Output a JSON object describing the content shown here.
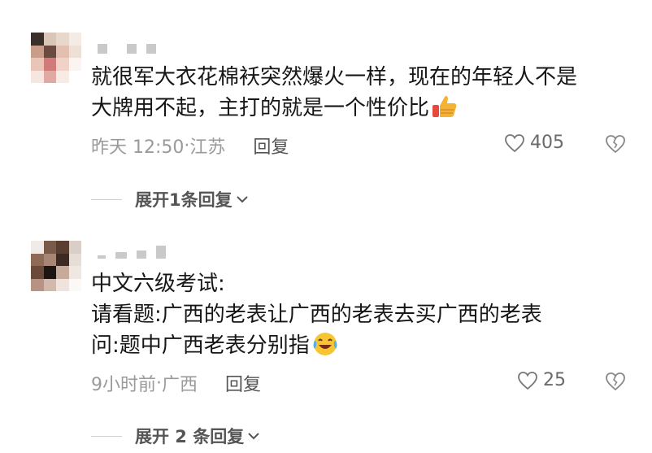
{
  "comments": [
    {
      "text_line1": "就很军大衣花棉袄突然爆火一样，现在的年轻人不是",
      "text_line2": "大牌用不起，主打的就是一个性价比",
      "emoji": "thumbs-up",
      "time": "昨天 12:50",
      "location": "江苏",
      "separator": "·",
      "reply_label": "回复",
      "likes": "405",
      "expand_label": "展开1条回复"
    },
    {
      "text_line1": "中文六级考试:",
      "text_line2": "请看题:广西的老表让广西的老表去买广西的老表",
      "text_line3": "问:题中广西老表分别指",
      "emoji": "crying-laughing-face",
      "time": "9小时前",
      "location": "广西",
      "separator": "·",
      "reply_label": "回复",
      "likes": "25",
      "expand_label": "展开 2 条回复"
    }
  ],
  "icons": {
    "like": "heart-outline-icon",
    "dislike": "broken-heart-icon",
    "expand": "chevron-down-icon"
  }
}
